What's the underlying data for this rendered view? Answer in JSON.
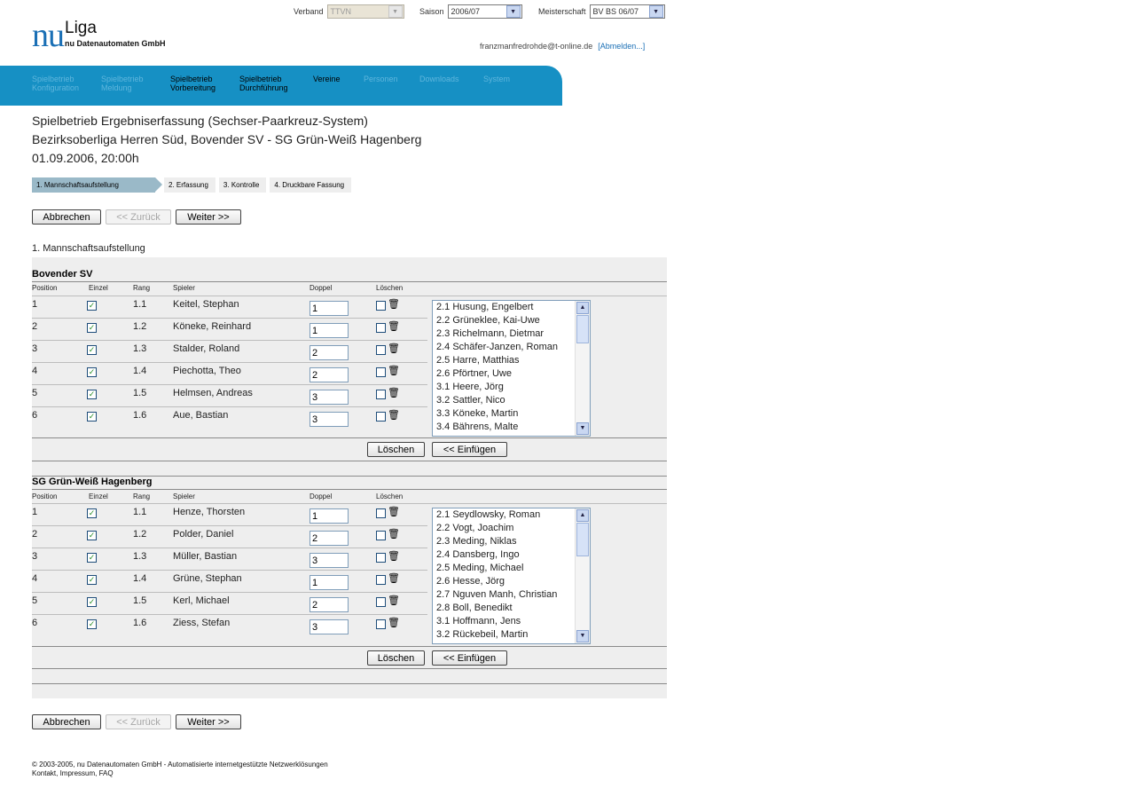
{
  "header": {
    "logo_nu": "nu",
    "logo_liga": "Liga",
    "logo_sub": "nu Datenautomaten GmbH",
    "verband_label": "Verband",
    "verband_value": "TTVN",
    "saison_label": "Saison",
    "saison_value": "2006/07",
    "meisterschaft_label": "Meisterschaft",
    "meisterschaft_value": "BV BS 06/07",
    "user_email": "franzmanfredrohde@t-online.de",
    "logout": "[Abmelden...]"
  },
  "nav": [
    {
      "l1": "Spielbetrieb",
      "l2": "Konfiguration"
    },
    {
      "l1": "Spielbetrieb",
      "l2": "Meldung"
    },
    {
      "l1": "Spielbetrieb",
      "l2": "Vorbereitung"
    },
    {
      "l1": "Spielbetrieb",
      "l2": "Durchführung"
    },
    {
      "l1": "Vereine",
      "l2": ""
    },
    {
      "l1": "Personen",
      "l2": ""
    },
    {
      "l1": "Downloads",
      "l2": ""
    },
    {
      "l1": "System",
      "l2": ""
    }
  ],
  "page": {
    "title": "Spielbetrieb Ergebniserfassung (Sechser-Paarkreuz-System)",
    "match": "Bezirksoberliga Herren Süd, Bovender SV - SG Grün-Weiß Hagenberg",
    "datetime": "01.09.2006, 20:00h"
  },
  "steps": [
    "1. Mannschaftsaufstellung",
    "2. Erfassung",
    "3. Kontrolle",
    "4. Druckbare Fassung"
  ],
  "buttons": {
    "cancel": "Abbrechen",
    "back": "<< Zurück",
    "next": "Weiter >>",
    "delete": "Löschen",
    "insert": "<< Einfügen"
  },
  "section_label": "1. Mannschaftsaufstellung",
  "columns": {
    "position": "Position",
    "einzel": "Einzel",
    "rang": "Rang",
    "spieler": "Spieler",
    "doppel": "Doppel",
    "loeschen": "Löschen"
  },
  "teams": [
    {
      "name": "Bovender SV",
      "rows": [
        {
          "pos": "1",
          "rang": "1.1",
          "spieler": "Keitel, Stephan",
          "doppel": "1"
        },
        {
          "pos": "2",
          "rang": "1.2",
          "spieler": "Köneke, Reinhard",
          "doppel": "1"
        },
        {
          "pos": "3",
          "rang": "1.3",
          "spieler": "Stalder, Roland",
          "doppel": "2"
        },
        {
          "pos": "4",
          "rang": "1.4",
          "spieler": "Piechotta, Theo",
          "doppel": "2"
        },
        {
          "pos": "5",
          "rang": "1.5",
          "spieler": "Helmsen, Andreas",
          "doppel": "3"
        },
        {
          "pos": "6",
          "rang": "1.6",
          "spieler": "Aue, Bastian",
          "doppel": "3"
        }
      ],
      "reserve": [
        "2.1 Husung, Engelbert",
        "2.2 Grüneklee, Kai-Uwe",
        "2.3 Richelmann, Dietmar",
        "2.4 Schäfer-Janzen, Roman",
        "2.5 Harre, Matthias",
        "2.6 Pförtner, Uwe",
        "3.1 Heere, Jörg",
        "3.2 Sattler, Nico",
        "3.3 Köneke, Martin",
        "3.4 Bährens, Malte"
      ]
    },
    {
      "name": "SG Grün-Weiß Hagenberg",
      "rows": [
        {
          "pos": "1",
          "rang": "1.1",
          "spieler": "Henze, Thorsten",
          "doppel": "1"
        },
        {
          "pos": "2",
          "rang": "1.2",
          "spieler": "Polder, Daniel",
          "doppel": "2"
        },
        {
          "pos": "3",
          "rang": "1.3",
          "spieler": "Müller, Bastian",
          "doppel": "3"
        },
        {
          "pos": "4",
          "rang": "1.4",
          "spieler": "Grüne, Stephan",
          "doppel": "1"
        },
        {
          "pos": "5",
          "rang": "1.5",
          "spieler": "Kerl, Michael",
          "doppel": "2"
        },
        {
          "pos": "6",
          "rang": "1.6",
          "spieler": "Ziess, Stefan",
          "doppel": "3"
        }
      ],
      "reserve": [
        "2.1 Seydlowsky, Roman",
        "2.2 Vogt, Joachim",
        "2.3 Meding, Niklas",
        "2.4 Dansberg, Ingo",
        "2.5 Meding, Michael",
        "2.6 Hesse, Jörg",
        "2.7 Nguven Manh, Christian",
        "2.8 Boll, Benedikt",
        "3.1 Hoffmann, Jens",
        "3.2 Rückebeil, Martin"
      ]
    }
  ],
  "footer": {
    "line1": "© 2003-2005, nu Datenautomaten GmbH - Automatisierte internetgestützte Netzwerklösungen",
    "line2": "Kontakt, Impressum, FAQ"
  }
}
